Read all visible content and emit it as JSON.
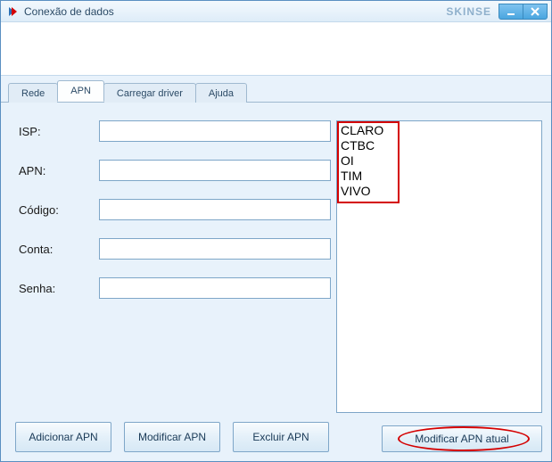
{
  "window": {
    "title": "Conexão de dados",
    "brand": "SKINSE"
  },
  "tabs": {
    "rede": "Rede",
    "apn": "APN",
    "carregar": "Carregar driver",
    "ajuda": "Ajuda"
  },
  "form": {
    "isp_label": "ISP:",
    "apn_label": "APN:",
    "codigo_label": "Código:",
    "conta_label": "Conta:",
    "senha_label": "Senha:",
    "isp_value": "",
    "apn_value": "",
    "codigo_value": "",
    "conta_value": "",
    "senha_value": ""
  },
  "buttons": {
    "adicionar": "Adicionar APN",
    "modificar": "Modificar APN",
    "excluir": "Excluir APN",
    "modificar_atual": "Modificar APN atual"
  },
  "list": {
    "items": [
      "CLARO",
      "CTBC",
      "OI",
      "TIM",
      "VIVO"
    ]
  }
}
